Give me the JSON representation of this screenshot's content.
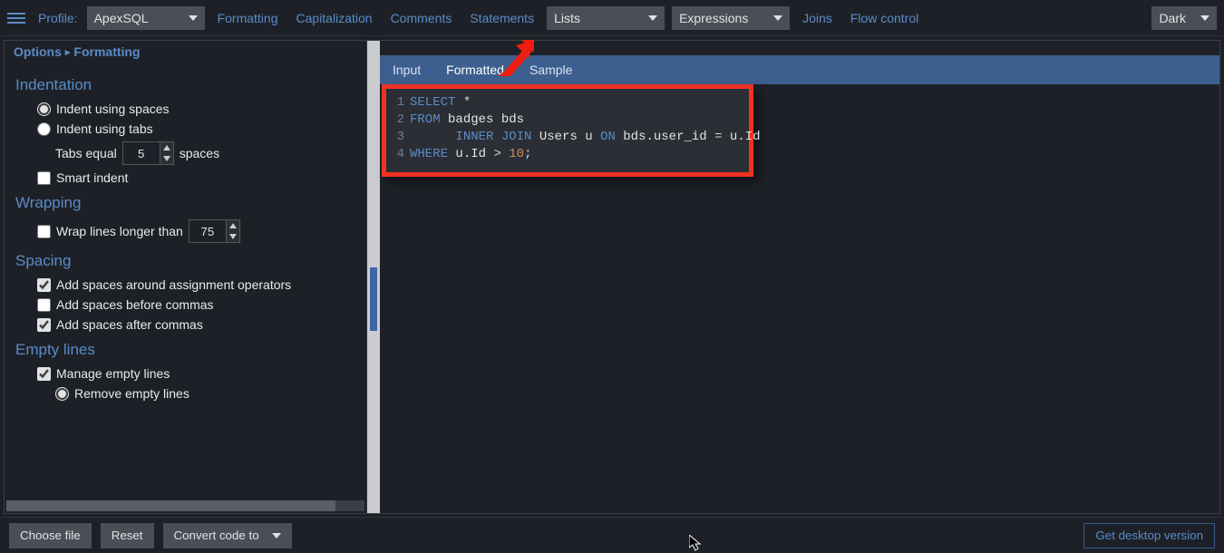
{
  "topbar": {
    "profile_label": "Profile:",
    "profile_value": "ApexSQL",
    "links": {
      "formatting": "Formatting",
      "capitalization": "Capitalization",
      "comments": "Comments",
      "statements": "Statements",
      "joins": "Joins",
      "flow": "Flow control"
    },
    "dropdowns": {
      "lists": "Lists",
      "expressions": "Expressions",
      "theme": "Dark"
    }
  },
  "breadcrumb": {
    "root": "Options",
    "leaf": "Formatting"
  },
  "options": {
    "indentation": {
      "title": "Indentation",
      "spaces_label": "Indent using spaces",
      "tabs_label": "Indent using tabs",
      "tabs_equal_pre": "Tabs equal",
      "tabs_equal_val": "5",
      "tabs_equal_post": "spaces",
      "smart_indent": "Smart indent"
    },
    "wrapping": {
      "title": "Wrapping",
      "wrap_label": "Wrap lines longer than",
      "wrap_val": "75"
    },
    "spacing": {
      "title": "Spacing",
      "around_assign": "Add spaces around assignment operators",
      "before_commas": "Add spaces before commas",
      "after_commas": "Add spaces after commas"
    },
    "empty": {
      "title": "Empty lines",
      "manage": "Manage empty lines",
      "remove": "Remove empty lines"
    }
  },
  "tabs": {
    "input": "Input",
    "formatted": "Formatted",
    "sample": "Sample"
  },
  "code": {
    "lines": [
      {
        "n": "1",
        "t": [
          [
            "kw",
            "SELECT"
          ],
          [
            "op",
            " "
          ],
          [
            "star",
            "*"
          ]
        ]
      },
      {
        "n": "2",
        "t": [
          [
            "kw",
            "FROM"
          ],
          [
            "id",
            " badges bds"
          ]
        ]
      },
      {
        "n": "3",
        "t": [
          [
            "op",
            "      "
          ],
          [
            "kw",
            "INNER JOIN"
          ],
          [
            "id",
            " Users u "
          ],
          [
            "kw",
            "ON"
          ],
          [
            "id",
            " bds.user_id "
          ],
          [
            "op",
            "="
          ],
          [
            "id",
            " u.Id"
          ]
        ]
      },
      {
        "n": "4",
        "t": [
          [
            "kw",
            "WHERE"
          ],
          [
            "id",
            " u.Id "
          ],
          [
            "op",
            ">"
          ],
          [
            "op",
            " "
          ],
          [
            "num",
            "10"
          ],
          [
            "op",
            ";"
          ]
        ]
      }
    ]
  },
  "bottom": {
    "choose": "Choose file",
    "reset": "Reset",
    "convert": "Convert code to",
    "desktop": "Get desktop version"
  }
}
